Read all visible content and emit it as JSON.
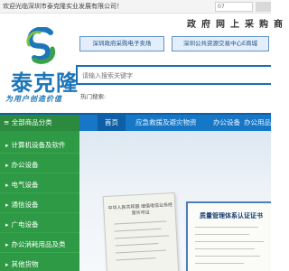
{
  "topbar": {
    "welcome": "欢迎光临深圳市泰克隆实业发展有限公司！",
    "login_value": "07"
  },
  "logo": {
    "name": "泰克隆",
    "slogan": "为用户创造价值"
  },
  "header": {
    "title": "政府网上采购商",
    "market_buttons": [
      "深圳政府采购电子卖场",
      "深圳公共资源交易中心E商城"
    ]
  },
  "search": {
    "placeholder": "请输入搜索关键字",
    "hot_label": "热门搜索:"
  },
  "nav": {
    "category_header": "全部商品分类",
    "items": [
      "首页",
      "应急救援及避灾物资",
      "办公设备",
      "办公用品",
      "个护"
    ]
  },
  "categories": [
    "计算机设备及软件",
    "办公设备",
    "电气设备",
    "通信设备",
    "广电设备",
    "办公消耗用品及类",
    "其他货物"
  ],
  "banner": {
    "cert1_title": "中华人民共和国 增值电信业务经营许可证",
    "cert2_title": "质量管理体系认证证书"
  },
  "colors": {
    "brand_blue": "#1677c7",
    "category_green": "#2f9a46"
  }
}
